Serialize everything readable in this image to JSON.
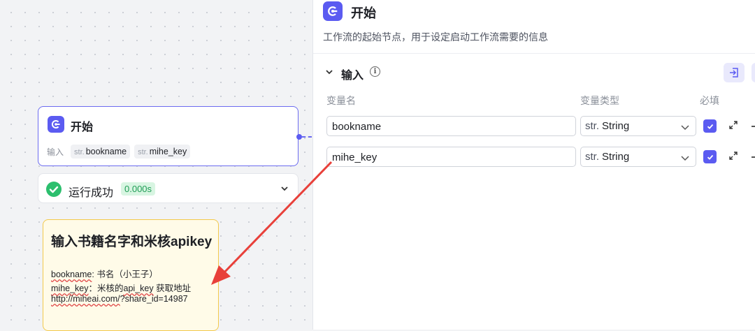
{
  "canvas": {
    "start_node": {
      "title": "开始",
      "inputs_label": "输入",
      "inputs": [
        {
          "type": "str.",
          "name": "bookname"
        },
        {
          "type": "str.",
          "name": "mihe_key"
        }
      ]
    },
    "run_status": {
      "text": "运行成功",
      "time": "0.000s"
    },
    "note": {
      "title": "输入书籍名字和米核apikey",
      "line1_key": "bookname",
      "line1_rest": ": 书名（小王子）",
      "line2_key": "mihe_key",
      "line2_rest": "：米核的",
      "line2_api": "api_key",
      "line2_end": " 获取地址",
      "line3_link": "http://miheai.com/",
      "line3_rest": "?share_id=14987"
    }
  },
  "panel": {
    "title": "开始",
    "description": "工作流的起始节点，用于设定启动工作流需要的信息",
    "section_title": "输入",
    "columns": {
      "name": "变量名",
      "type": "变量类型",
      "required": "必填"
    },
    "variables": [
      {
        "name": "bookname",
        "type_prefix": "str.",
        "type": "String",
        "required": true
      },
      {
        "name": "mihe_key",
        "type_prefix": "str.",
        "type": "String",
        "required": true
      }
    ]
  },
  "colors": {
    "accent": "#5b5bf1",
    "success": "#2cbf6e",
    "arrow": "#e8403a",
    "note_border": "#f2c94c"
  }
}
